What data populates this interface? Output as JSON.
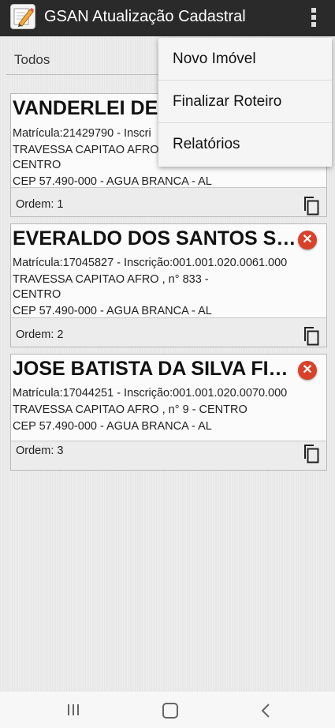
{
  "app": {
    "title": "GSAN Atualização Cadastral",
    "icons": {
      "app": "pencil-notepad-icon",
      "overflow": "vertical-dots-icon"
    }
  },
  "filter": {
    "label": "Todos"
  },
  "menu": {
    "items": [
      {
        "label": "Novo Imóvel"
      },
      {
        "label": "Finalizar Roteiro"
      },
      {
        "label": "Relatórios"
      }
    ]
  },
  "cards": [
    {
      "name": "VANDERLEI DE",
      "matricula": "Matrícula:21429790  -  Inscri",
      "address1": "TRAVESSA CAPITAO AFRO",
      "address2": "CENTRO",
      "cep": "CEP 57.490-000 - AGUA BRANCA - AL",
      "order": "Ordem: 1"
    },
    {
      "name": "EVERALDO DOS SANTOS S…",
      "matricula": "Matrícula:17045827  -  Inscrição:001.001.020.0061.000",
      "address1": "TRAVESSA CAPITAO AFRO                        , n° 833 -",
      "address2": "CENTRO",
      "cep": "CEP 57.490-000 - AGUA BRANCA - AL",
      "order": "Ordem: 2"
    },
    {
      "name": "JOSE BATISTA DA SILVA FI…",
      "matricula": "Matrícula:17044251  -  Inscrição:001.001.020.0070.000",
      "address1": "TRAVESSA CAPITAO AFRO                        , n° 9 - CENTRO",
      "cep": "CEP 57.490-000 - AGUA BRANCA - AL",
      "order": "Ordem: 3"
    }
  ],
  "colors": {
    "appbar": "#2a2a2a",
    "delete": "#d9412b",
    "menu": "#f5f5f5"
  }
}
